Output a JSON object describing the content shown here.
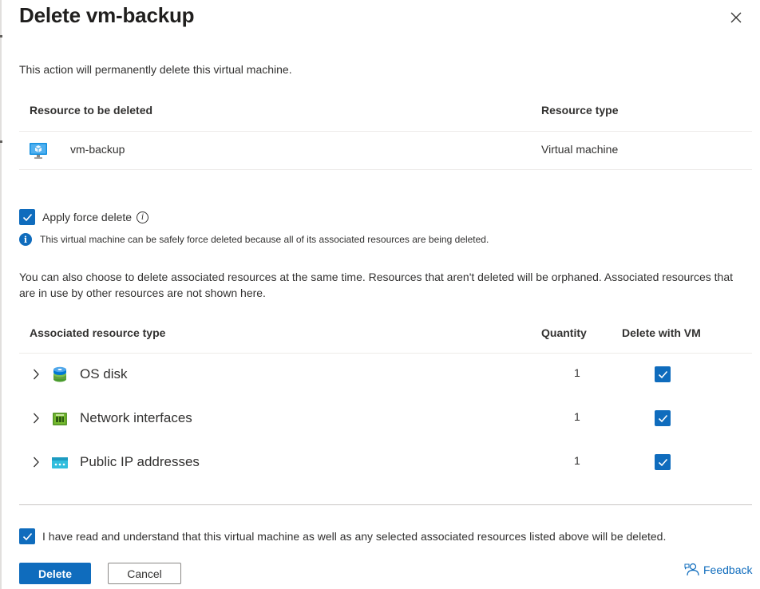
{
  "panel": {
    "title": "Delete vm-backup",
    "intro": "This action will permanently delete this virtual machine."
  },
  "resource_table": {
    "columns": [
      "Resource to be deleted",
      "Resource type"
    ],
    "rows": [
      {
        "icon": "virtual-machine-icon",
        "name": "vm-backup",
        "type": "Virtual machine"
      }
    ]
  },
  "force_delete": {
    "label": "Apply force delete",
    "checked": true,
    "notice": "This virtual machine can be safely force deleted because all of its associated resources are being deleted."
  },
  "associated": {
    "description": "You can also choose to delete associated resources at the same time. Resources that aren't deleted will be orphaned. Associated resources that are in use by other resources are not shown here.",
    "columns": [
      "Associated resource type",
      "Quantity",
      "Delete with VM"
    ],
    "rows": [
      {
        "icon": "os-disk-icon",
        "name": "OS disk",
        "quantity": "1",
        "delete_with_vm": true
      },
      {
        "icon": "network-interface-icon",
        "name": "Network interfaces",
        "quantity": "1",
        "delete_with_vm": true
      },
      {
        "icon": "public-ip-icon",
        "name": "Public IP addresses",
        "quantity": "1",
        "delete_with_vm": true
      }
    ]
  },
  "acknowledge": {
    "label": "I have read and understand that this virtual machine as well as any selected associated resources listed above will be deleted.",
    "checked": true
  },
  "actions": {
    "delete_label": "Delete",
    "cancel_label": "Cancel",
    "feedback_label": "Feedback"
  },
  "colors": {
    "accent": "#0f6cbd",
    "text": "#323130",
    "border": "#edebe9"
  }
}
